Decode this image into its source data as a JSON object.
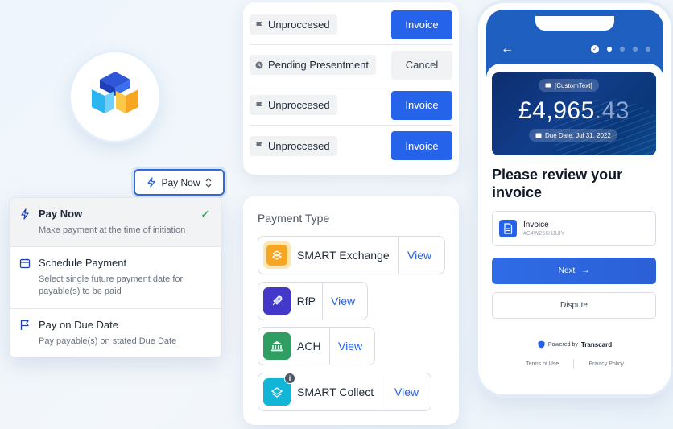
{
  "select": {
    "label": "Pay Now"
  },
  "dropdown": {
    "items": [
      {
        "title": "Pay Now",
        "desc": "Make payment at the time of initiation",
        "selected": true,
        "icon": "lightning-icon"
      },
      {
        "title": "Schedule Payment",
        "desc": "Select single future payment date for payable(s) to be paid",
        "selected": false,
        "icon": "calendar-icon"
      },
      {
        "title": "Pay on Due Date",
        "desc": "Pay payable(s) on stated Due Date",
        "selected": false,
        "icon": "flag-icon"
      }
    ]
  },
  "invoice_list": {
    "rows": [
      {
        "status": "Unproccesed",
        "status_icon": "flag-icon",
        "action": "Invoice",
        "action_style": "primary"
      },
      {
        "status": "Pending Presentment",
        "status_icon": "clock-icon",
        "action": "Cancel",
        "action_style": "secondary"
      },
      {
        "status": "Unproccesed",
        "status_icon": "flag-icon",
        "action": "Invoice",
        "action_style": "primary"
      },
      {
        "status": "Unproccesed",
        "status_icon": "flag-icon",
        "action": "Invoice",
        "action_style": "primary"
      }
    ]
  },
  "payment_type": {
    "title": "Payment Type",
    "view_label": "View",
    "options": [
      {
        "label": "SMART Exchange",
        "icon": "smart-exchange-icon",
        "color": "#f5a623"
      },
      {
        "label": "RfP",
        "icon": "rocket-icon",
        "color": "#4338ca"
      },
      {
        "label": "ACH",
        "icon": "bank-icon",
        "color": "#2f9e63"
      },
      {
        "label": "SMART Collect",
        "icon": "smart-collect-icon",
        "color": "#13b5d6",
        "info_badge": "i"
      }
    ]
  },
  "phone": {
    "custom_text": "[CustomText]",
    "amount_main": "£4,965",
    "amount_cents": ".43",
    "due_date": "Due Date: Jul 31, 2022",
    "review_title": "Please review your invoice",
    "invoice_label": "Invoice",
    "invoice_id": "#C4W256HJUIY",
    "next_label": "Next",
    "dispute_label": "Dispute",
    "powered_by": "Powered by",
    "brand": "Transcard",
    "terms": "Terms of Use",
    "privacy": "Privacy Policy"
  },
  "colors": {
    "primary": "#2563eb",
    "success": "#16a34a",
    "header": "#1e5fbf"
  }
}
